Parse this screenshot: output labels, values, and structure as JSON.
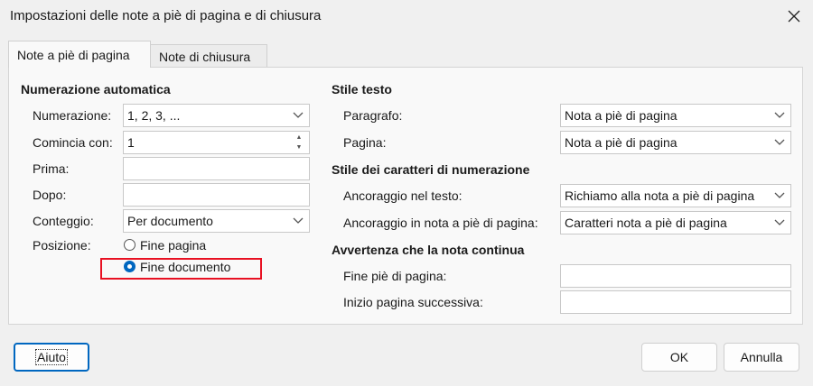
{
  "window": {
    "title": "Impostazioni delle note a piè di pagina e di chiusura"
  },
  "tabs": [
    {
      "label": "Note a piè di pagina",
      "active": true
    },
    {
      "label": "Note di chiusura",
      "active": false
    }
  ],
  "auto_numbering": {
    "heading": "Numerazione automatica",
    "numbering": {
      "label": "Numerazione:",
      "value": "1, 2, 3, ..."
    },
    "start_at": {
      "label": "Comincia con:",
      "value": "1"
    },
    "before": {
      "label": "Prima:",
      "value": ""
    },
    "after": {
      "label": "Dopo:",
      "value": ""
    },
    "count": {
      "label": "Conteggio:",
      "value": "Per documento"
    },
    "position": {
      "label": "Posizione:",
      "options": [
        {
          "label": "Fine pagina",
          "selected": false
        },
        {
          "label": "Fine documento",
          "selected": true
        }
      ]
    }
  },
  "text_style": {
    "heading": "Stile testo",
    "paragraph": {
      "label": "Paragrafo:",
      "value": "Nota a piè di pagina"
    },
    "page": {
      "label": "Pagina:",
      "value": "Nota a piè di pagina"
    }
  },
  "numbering_char_style": {
    "heading": "Stile dei caratteri di numerazione",
    "anchor_in_text": {
      "label": "Ancoraggio nel testo:",
      "value": "Richiamo alla nota a piè di pagina"
    },
    "anchor_in_footnote": {
      "label": "Ancoraggio in nota a piè di pagina:",
      "value": "Caratteri nota a piè di pagina"
    }
  },
  "continuation_notice": {
    "heading": "Avvertenza che la nota continua",
    "end_of_footnote": {
      "label": "Fine piè di pagina:",
      "value": ""
    },
    "next_page_start": {
      "label": "Inizio pagina successiva:",
      "value": ""
    }
  },
  "buttons": {
    "help": "Aiuto",
    "ok": "OK",
    "cancel": "Annulla"
  },
  "colors": {
    "accent": "#0067c0",
    "highlight": "#e81123"
  }
}
